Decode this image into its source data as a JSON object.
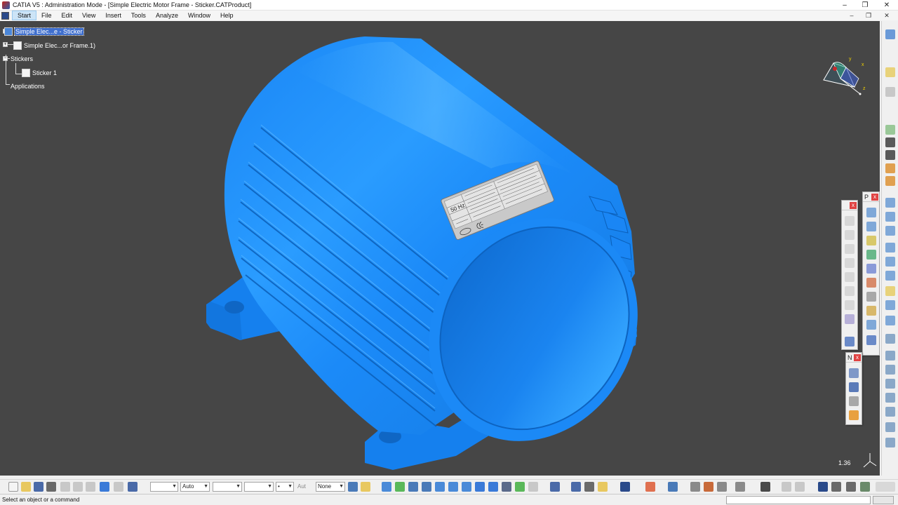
{
  "window": {
    "title": "CATIA V5 : Administration Mode - [Simple Electric Motor Frame - Sticker.CATProduct]",
    "minimize_glyph": "–",
    "restore_glyph": "❐",
    "close_glyph": "✕"
  },
  "menubar": {
    "items": [
      "Start",
      "File",
      "Edit",
      "View",
      "Insert",
      "Tools",
      "Analyze",
      "Window",
      "Help"
    ],
    "mdi_min_glyph": "–",
    "mdi_restore_glyph": "❐",
    "mdi_close_glyph": "✕"
  },
  "spec_tree": {
    "root": "Simple Elec...e - Sticker",
    "part": "Simple Elec...or Frame.1)",
    "stickers_folder": "Stickers",
    "sticker_item": "Sticker 1",
    "applications": "Applications"
  },
  "nameplate": {
    "frequency": "50 Hz"
  },
  "compass": {
    "x_label": "x",
    "y_label": "y",
    "z_label": "z"
  },
  "viewport": {
    "scale_readout": "1.36",
    "background_color": "#464646",
    "part_color": "#1e8cff"
  },
  "floating_toolbars": [
    {
      "title": "",
      "close_glyph": "x"
    },
    {
      "title": "P",
      "close_glyph": "x"
    },
    {
      "title": "N",
      "close_glyph": "x"
    }
  ],
  "bottom_toolbar": {
    "color_combo": "",
    "transparency_combo": "Auto",
    "linetype_combo": "",
    "thickness_combo": "",
    "point_combo": "•",
    "layer_label": "Aut",
    "layer_combo": "None"
  },
  "statusbar": {
    "prompt": "Select an object or a command",
    "command_value": ""
  }
}
